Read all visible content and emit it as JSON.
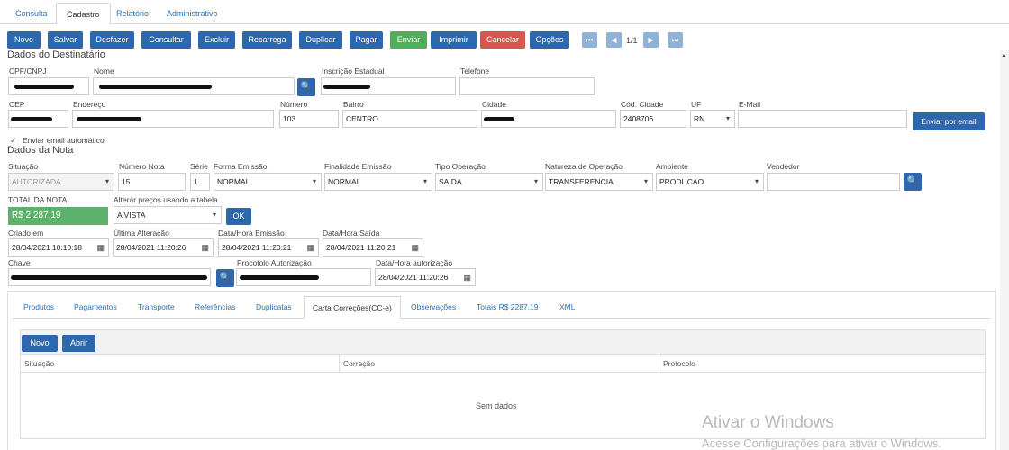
{
  "tabs": [
    "Consulta",
    "Cadastro",
    "Relatório",
    "Administrativo"
  ],
  "toolbar": {
    "buttons": [
      "Novo",
      "Salvar",
      "Desfazer",
      "Consultar",
      "Excluir",
      "Recarrega",
      "Duplicar",
      "Pagar",
      "Enviar",
      "Imprimir",
      "Cancelar",
      "Opções"
    ],
    "page": "1/1"
  },
  "destinatario": {
    "title": "Dados do Destinatário",
    "cpf_label": "CPF/CNPJ",
    "nome_label": "Nome",
    "ie_label": "Inscrição Estadual",
    "telefone_label": "Telefone",
    "cep_label": "CEP",
    "endereco_label": "Endereço",
    "numero_label": "Número",
    "numero": "103",
    "bairro_label": "Bairro",
    "bairro": "CENTRO",
    "cidade_label": "Cidade",
    "cod_cidade_label": "Cód. Cidade",
    "cod_cidade": "2408706",
    "uf_label": "UF",
    "uf": "RN",
    "email_label": "E-Mail",
    "enviar_email_btn": "Enviar por email",
    "email_auto": "Enviar email automático"
  },
  "nota": {
    "title": "Dados da Nota",
    "situacao_label": "Situação",
    "situacao": "AUTORIZADA",
    "numero_label": "Número Nota",
    "numero": "15",
    "serie_label": "Série",
    "serie": "1",
    "forma_label": "Forma Emissão",
    "forma": "NORMAL",
    "finalidade_label": "Finalidade Emissão",
    "finalidade": "NORMAL",
    "tipo_label": "Tipo Operação",
    "tipo": "SAIDA",
    "natureza_label": "Natureza de Operação",
    "natureza": "TRANSFERENCIA",
    "ambiente_label": "Ambiente",
    "ambiente": "PRODUCAO",
    "vendedor_label": "Vendedor",
    "total_label": "TOTAL DA NOTA",
    "total": "R$ 2.287,19",
    "tabela_label": "Alterar preços usando a tabela",
    "tabela": "A VISTA",
    "ok": "OK",
    "criado_label": "Criado em",
    "criado": "28/04/2021 10:10:18",
    "alteracao_label": "Última Alteração",
    "alteracao": "28/04/2021 11:20:26",
    "emissao_label": "Data/Hora Emissão",
    "emissao": "28/04/2021 11:20:21",
    "saida_label": "Data/Hora Saída",
    "saida": "28/04/2021 11:20:21",
    "chave_label": "Chave",
    "protocolo_label": "Procotolo Autorização",
    "autorizacao_label": "Data/Hora autorização",
    "autorizacao": "28/04/2021 11:20:26"
  },
  "subtabs": [
    "Produtos",
    "Pagamentos",
    "Transporte",
    "Referências",
    "Duplicatas",
    "Carta Correções(CC-e)",
    "Observações",
    "Totais R$ 2287.19",
    "XML"
  ],
  "grid": {
    "new_btn": "Novo",
    "open_btn": "Abrir",
    "columns": [
      "Situação",
      "Correção",
      "Protocolo"
    ],
    "empty": "Sem dados"
  },
  "watermark": {
    "line1": "Ativar o Windows",
    "line2": "Acesse Configurações para ativar o Windows."
  },
  "colors": {
    "primary": "#2e67ae",
    "success": "#4fae5b",
    "danger": "#d9534f",
    "total_bg": "#5cb16b"
  }
}
